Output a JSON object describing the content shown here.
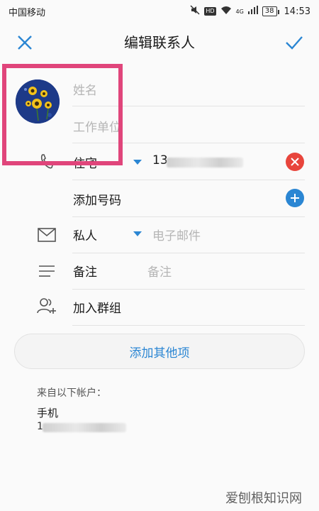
{
  "status_bar": {
    "carrier": "中国移动",
    "battery": "38",
    "time": "14:53",
    "hd": "HD",
    "signal": "4G"
  },
  "header": {
    "title": "编辑联系人"
  },
  "fields": {
    "name_placeholder": "姓名",
    "company_placeholder": "工作单位",
    "phone_type": "住宅",
    "phone_value_prefix": "13",
    "add_number_label": "添加号码",
    "email_type": "私人",
    "email_placeholder": "电子邮件",
    "note_label": "备注",
    "note_placeholder": "备注",
    "group_label": "加入群组"
  },
  "add_more_button": "添加其他项",
  "account": {
    "from_label": "来自以下帐户：",
    "name": "手机",
    "number_prefix": "1"
  },
  "watermark": "爱刨根知识网",
  "colors": {
    "accent": "#2b86d3",
    "delete": "#e8453c",
    "highlight": "#e0457b"
  }
}
